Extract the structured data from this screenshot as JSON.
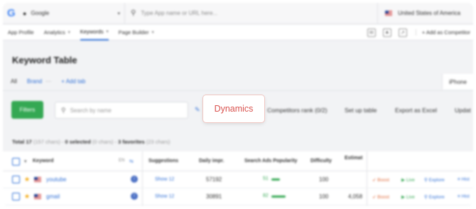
{
  "topbar": {
    "store_label": "Google",
    "search_placeholder": "Type App name or URL here...",
    "country_label": "United States of America"
  },
  "nav": {
    "items": [
      {
        "label": "App Profile"
      },
      {
        "label": "Analytics"
      },
      {
        "label": "Keywords"
      },
      {
        "label": "Page Builder"
      }
    ],
    "add_competitor": "+ Add as Competitor"
  },
  "page_title": "Keyword Table",
  "tabs": {
    "all": "All",
    "brand": "Brand",
    "add": "+ Add tab",
    "right": "iPhone"
  },
  "toolbar": {
    "filters": "Filters",
    "search_placeholder": "Search by name",
    "dynamics": "Dynamics",
    "competitors": "Competitors rank (0/2)",
    "setup": "Set up table",
    "export": "Export as Excel",
    "update": "Updat"
  },
  "totals": {
    "total": "Total 17",
    "total_chars": "(157 chars)",
    "selected": "0 selected",
    "selected_chars": "(0 chars)",
    "favorites": "3 favorites",
    "favorites_chars": "(23 chars)"
  },
  "table": {
    "columns": {
      "keyword": "Keyword",
      "suggestions": "Suggestions",
      "daily": "Daily impr.",
      "popularity": "Search Ads Popularity",
      "difficulty": "Difficulty",
      "estimated": "Estimat"
    },
    "rows": [
      {
        "keyword": "youtube",
        "suggestions": "Show 12",
        "daily": "57192",
        "popularity": "51",
        "pop_fraction": 0.51,
        "difficulty": "100",
        "estimated": ""
      },
      {
        "keyword": "gmail",
        "suggestions": "Show 12",
        "daily": "30891",
        "popularity": "82",
        "pop_fraction": 0.82,
        "difficulty": "100",
        "estimated": "4,058"
      }
    ],
    "actions": {
      "boost": "Boost",
      "live": "Live",
      "explore": "Explore",
      "history": "Hist"
    }
  },
  "colors": {
    "accent": "#2f6fd6",
    "green": "#34a853",
    "dynamics_text": "#d9534f"
  }
}
